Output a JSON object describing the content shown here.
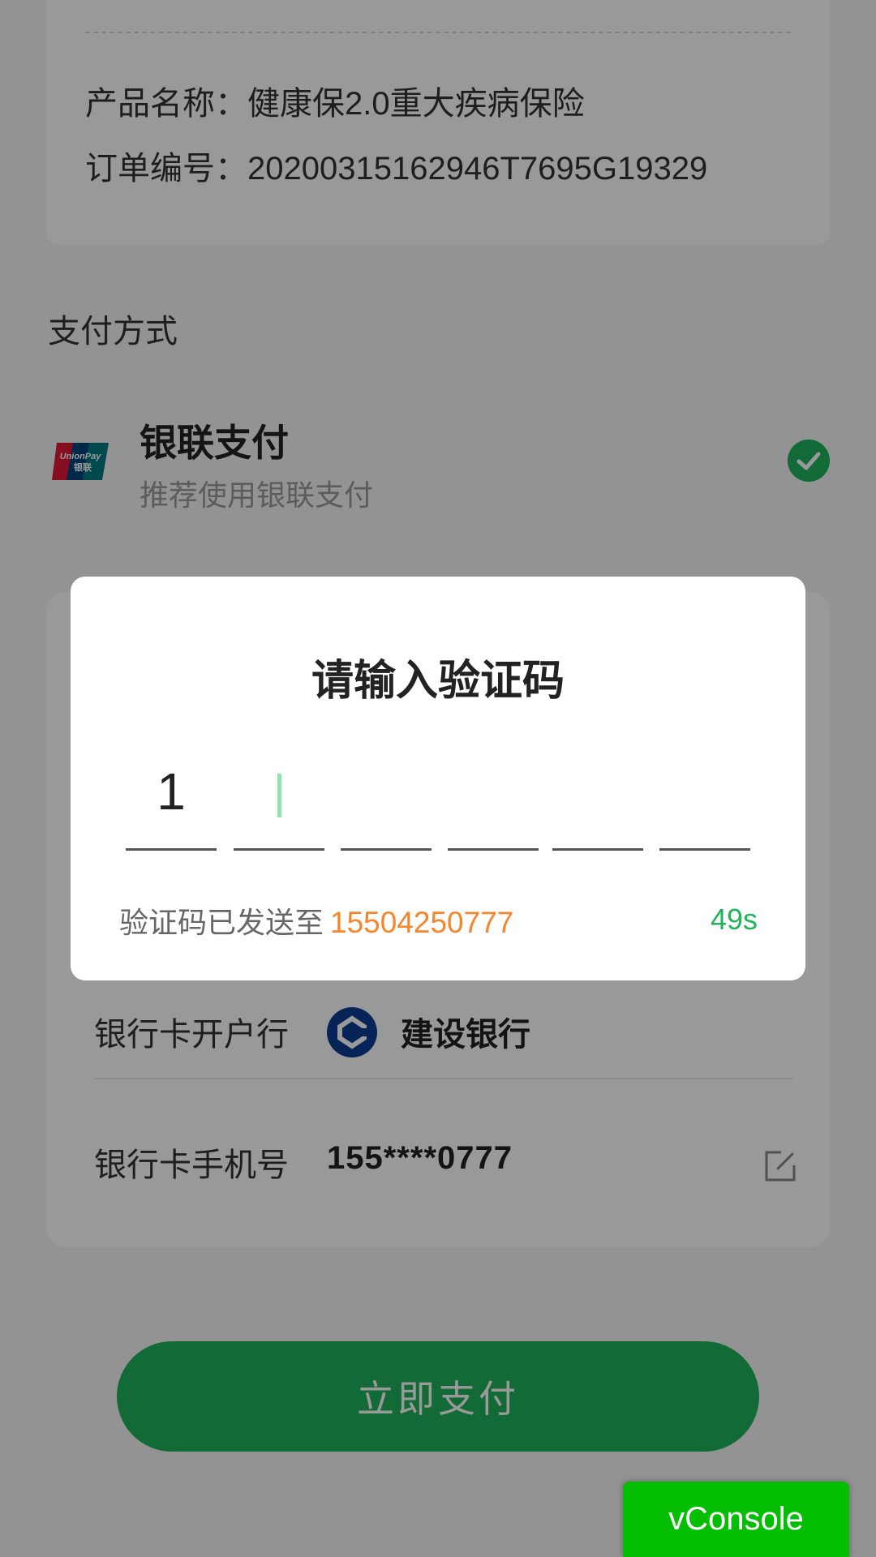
{
  "order": {
    "product_label": "产品名称：",
    "product_value": "健康保2.0重大疾病保险",
    "order_label": "订单编号：",
    "order_value": "20200315162946T7695G19329"
  },
  "payment": {
    "section_title": "支付方式",
    "method_name": "银联支付",
    "method_desc": "推荐使用银联支付",
    "method_icon": "unionpay-icon",
    "selected": true
  },
  "card_form": {
    "bank_label": "银行卡开户行",
    "bank_name": "建设银行",
    "bank_icon": "ccb-logo-icon",
    "phone_label": "银行卡手机号",
    "phone_value": "155****0777"
  },
  "pay_button_label": "立即支付",
  "vconsole_label": "vConsole",
  "modal": {
    "title": "请输入验证码",
    "code_digits": [
      "1",
      "",
      "",
      "",
      "",
      ""
    ],
    "active_index": 1,
    "sent_prefix": "验证码已发送至",
    "sent_phone": "15504250777",
    "countdown": "49s"
  },
  "colors": {
    "accent_green": "#1fb35a",
    "phone_orange": "#f5862b",
    "vconsole_green": "#04be02"
  }
}
